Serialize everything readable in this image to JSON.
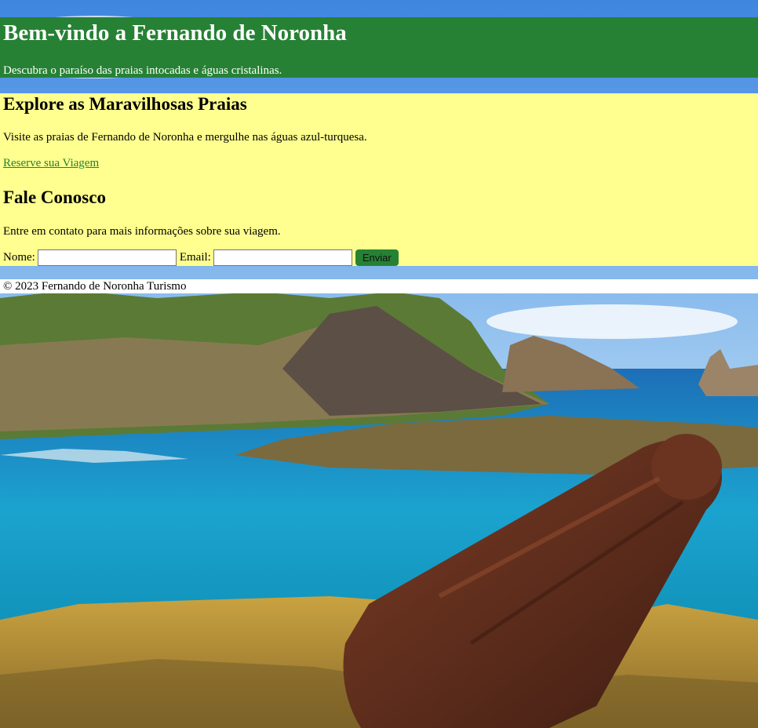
{
  "header": {
    "title": "Bem-vindo a Fernando de Noronha",
    "subtitle": "Descubra o paraíso das praias intocadas e águas cristalinas."
  },
  "explore": {
    "heading": "Explore as Maravilhosas Praias",
    "text": "Visite as praias de Fernando de Noronha e mergulhe nas águas azul-turquesa.",
    "link_label": "Reserve sua Viagem"
  },
  "contact": {
    "heading": "Fale Conosco",
    "text": "Entre em contato para mais informações sobre sua viagem.",
    "name_label": "Nome:",
    "name_value": "",
    "email_label": "Email:",
    "email_value": "",
    "submit_label": "Enviar"
  },
  "footer": {
    "text": "© 2023 Fernando de Noronha Turismo"
  },
  "colors": {
    "header_bg": "#268134",
    "main_bg": "#ffff8f",
    "link": "#268134",
    "button_bg": "#268134"
  },
  "background": {
    "icon": "beach-landscape-with-rusty-cannon"
  }
}
